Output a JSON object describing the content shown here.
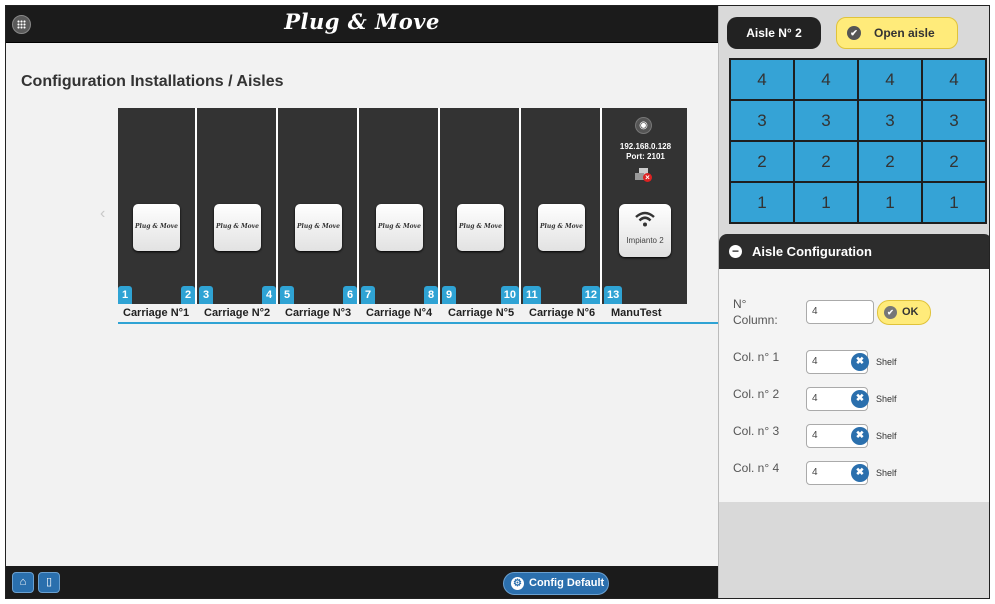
{
  "app": {
    "title": "Plug & Move"
  },
  "page": {
    "title": "Configuration Installations / Aisles"
  },
  "carriages": [
    {
      "label": "Carriage N°1",
      "logo": "Plug & Move",
      "left_num": "1",
      "right_num": "2"
    },
    {
      "label": "Carriage N°2",
      "logo": "Plug & Move",
      "left_num": "3",
      "right_num": "4"
    },
    {
      "label": "Carriage N°3",
      "logo": "Plug & Move",
      "left_num": "5",
      "right_num": "6"
    },
    {
      "label": "Carriage N°4",
      "logo": "Plug & Move",
      "left_num": "7",
      "right_num": "8"
    },
    {
      "label": "Carriage N°5",
      "logo": "Plug & Move",
      "left_num": "9",
      "right_num": "10"
    },
    {
      "label": "Carriage N°6",
      "logo": "Plug & Move",
      "left_num": "11",
      "right_num": "12"
    }
  ],
  "manutest": {
    "label": "ManuTest",
    "ip": "192.168.0.128",
    "port": "Port: 2101",
    "device_label": "Impianto 2",
    "num": "13"
  },
  "bottom": {
    "config_default": "Config Default"
  },
  "aisle": {
    "name": "Aisle N° 2",
    "open_label": "Open aisle",
    "grid": [
      [
        "4",
        "4",
        "4",
        "4"
      ],
      [
        "3",
        "3",
        "3",
        "3"
      ],
      [
        "2",
        "2",
        "2",
        "2"
      ],
      [
        "1",
        "1",
        "1",
        "1"
      ]
    ]
  },
  "config": {
    "title": "Aisle Configuration",
    "column_label": "N° Column:",
    "column_value": "4",
    "ok_label": "OK",
    "shelf_label": "Shelf",
    "columns": [
      {
        "label": "Col. n° 1",
        "value": "4"
      },
      {
        "label": "Col. n° 2",
        "value": "4"
      },
      {
        "label": "Col. n° 3",
        "value": "4"
      },
      {
        "label": "Col. n° 4",
        "value": "4"
      }
    ]
  }
}
